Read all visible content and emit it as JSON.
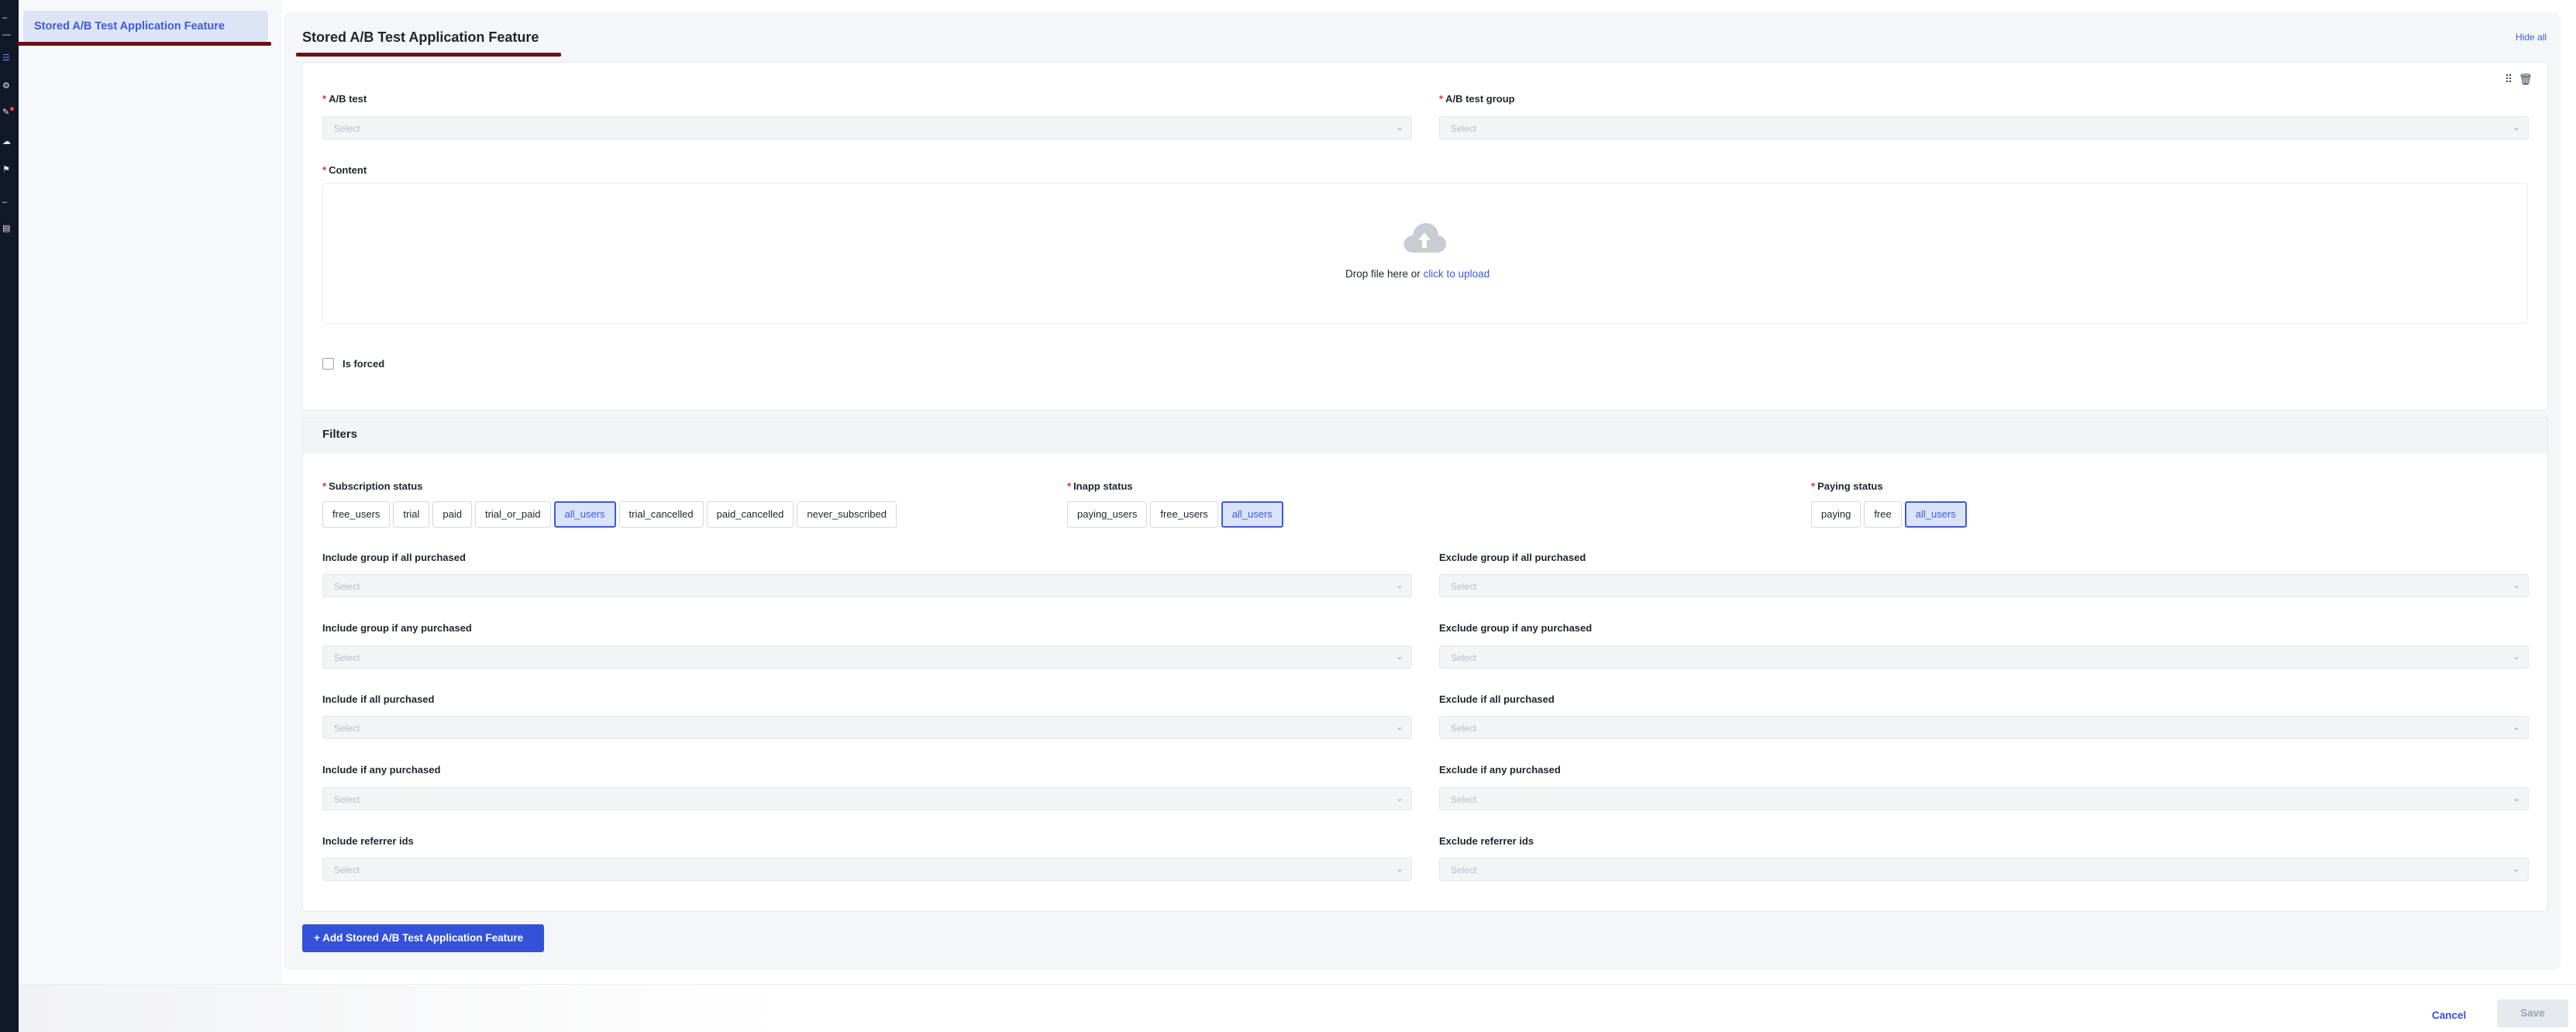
{
  "sidebar": {
    "active_item": "Stored A/B Test Application Feature"
  },
  "section": {
    "title": "Stored A/B Test Application Feature",
    "hide_all": "Hide all"
  },
  "form": {
    "ab_test_label": "A/B test",
    "ab_test_placeholder": "Select",
    "ab_test_group_label": "A/B test group",
    "ab_test_group_placeholder": "Select",
    "content_label": "Content",
    "drop_text": "Drop file here or",
    "upload_link": "click to upload",
    "is_forced_label": "Is forced"
  },
  "filters": {
    "title": "Filters",
    "subscription_status": {
      "label": "Subscription status",
      "options": [
        "free_users",
        "trial",
        "paid",
        "trial_or_paid",
        "all_users",
        "trial_cancelled",
        "paid_cancelled",
        "never_subscribed"
      ],
      "selected": "all_users"
    },
    "inapp_status": {
      "label": "Inapp status",
      "options": [
        "paying_users",
        "free_users",
        "all_users"
      ],
      "selected": "all_users"
    },
    "paying_status": {
      "label": "Paying status",
      "options": [
        "paying",
        "free",
        "all_users"
      ],
      "selected": "all_users"
    },
    "include_group_all": "Include group if all purchased",
    "exclude_group_all": "Exclude group if all purchased",
    "include_group_any": "Include group if any purchased",
    "exclude_group_any": "Exclude group if any purchased",
    "include_all": "Include if all purchased",
    "exclude_all": "Exclude if all purchased",
    "include_any": "Include if any purchased",
    "exclude_any": "Exclude if any purchased",
    "include_referrer": "Include referrer ids",
    "exclude_referrer": "Exclude referrer ids",
    "placeholder": "Select"
  },
  "actions": {
    "add_label": "+ Add Stored A/B Test Application Feature",
    "cancel_label": "Cancel",
    "save_label": "Save"
  },
  "colors": {
    "accent": "#3352d9",
    "active_underline": "#6b0f12",
    "required": "#e03131"
  },
  "icons": [
    "drag-handle-icon",
    "trash-icon",
    "cloud-upload-icon",
    "chevron-down-icon"
  ]
}
